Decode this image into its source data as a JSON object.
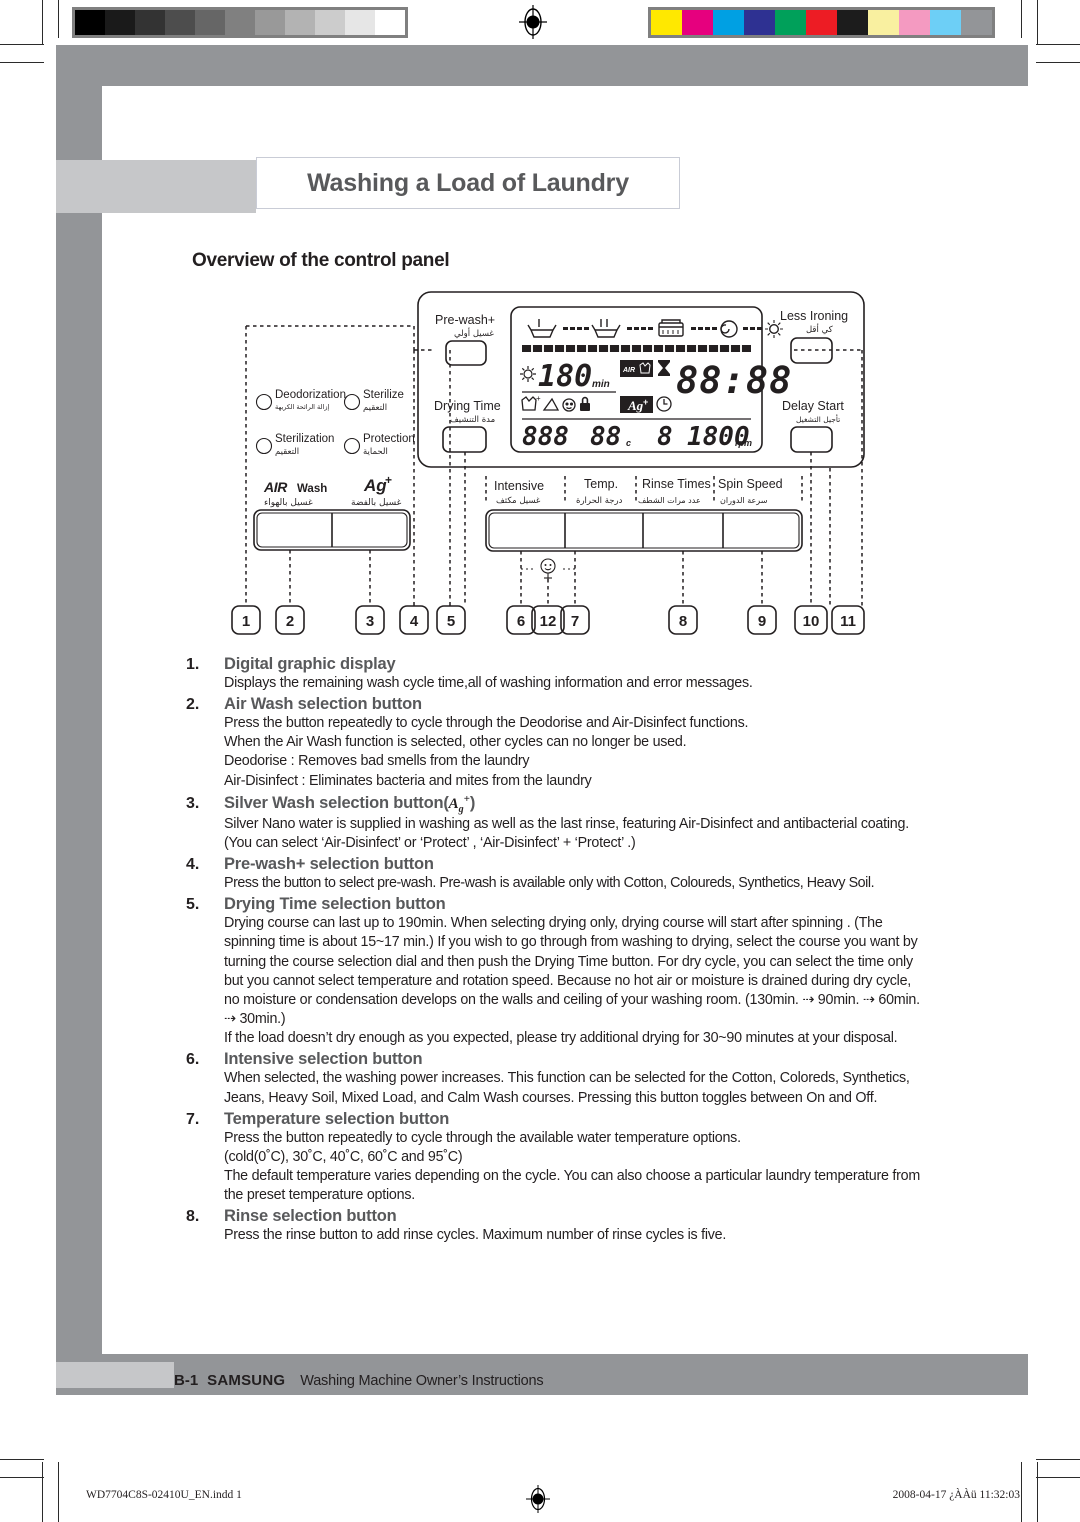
{
  "document": {
    "chapter_title": "Washing a Load of Laundry",
    "section_heading": "Overview of the control panel"
  },
  "calibration": {
    "gray_swatches": [
      "#000000",
      "#1a1a1a",
      "#333333",
      "#4d4d4d",
      "#666666",
      "#808080",
      "#999999",
      "#b3b3b3",
      "#cccccc",
      "#e6e6e6",
      "#ffffff"
    ],
    "color_swatches": [
      "#ffe800",
      "#e6007e",
      "#00a0e3",
      "#2e3192",
      "#00a05a",
      "#ed1c24",
      "#1c1c1c",
      "#f9f0a0",
      "#f49ac1",
      "#6dcff6",
      "#939598"
    ]
  },
  "diagram": {
    "name": "washing-machine-control-panel",
    "indicators": [
      {
        "en": "Deodorization",
        "ar": "إزالة الرائحة الكريهة"
      },
      {
        "en": "Sterilize",
        "ar": "التعقيم"
      },
      {
        "en": "Sterilization",
        "ar": "التعقيم"
      },
      {
        "en": "Protection",
        "ar": "الحماية"
      }
    ],
    "left_buttons": [
      {
        "en": "AIR Wash",
        "ar": "غسيل بالهواء"
      },
      {
        "en": "Ag+",
        "ar": "غسيل بالفضة"
      }
    ],
    "column_buttons": [
      {
        "en": "Pre-wash+",
        "ar": "غسيل أولي"
      },
      {
        "en": "Drying Time",
        "ar": "مدة التنشيف"
      }
    ],
    "right_buttons": [
      {
        "en": "Less Ironing",
        "ar": "كي أقل"
      },
      {
        "en": "Delay Start",
        "ar": "تأجيل التشغيل"
      }
    ],
    "center_buttons": [
      {
        "en": "Intensive",
        "ar": "غسيل مكثف"
      },
      {
        "en": "Temp.",
        "ar": "درجة الحرارة"
      },
      {
        "en": "Rinse Times",
        "ar": "عدد مرات الشطف"
      },
      {
        "en": "Spin Speed",
        "ar": "سرعة الدوران"
      }
    ],
    "lcd": {
      "drying_value": "180",
      "drying_unit": "min",
      "main_time": "88:88",
      "bottom_course": "888",
      "bottom_temp": "88",
      "bottom_temp_unit": "c",
      "bottom_rinse": "8",
      "bottom_spin": "1800",
      "bottom_spin_unit": "rpm",
      "badge_air": "AIR",
      "badge_silver": "Ag+"
    },
    "callouts": [
      "1",
      "2",
      "3",
      "4",
      "5",
      "6",
      "12",
      "7",
      "8",
      "9",
      "10",
      "11"
    ]
  },
  "instructions": [
    {
      "num": "1.",
      "title": "Digital graphic display",
      "body": [
        "Displays the remaining wash cycle time,all of washing information and error messages."
      ]
    },
    {
      "num": "2.",
      "title": "Air Wash selection button",
      "body": [
        "Press the button repeatedly to cycle through the Deodorise and Air-Disinfect functions.",
        "When the Air Wash function is selected, other cycles can no longer be used.",
        "Deodorise :  Removes bad smells from the laundry",
        "Air-Disinfect :  Eliminates bacteria and mites from the laundry"
      ]
    },
    {
      "num": "3.",
      "title": "Silver Wash selection button(",
      "title_suffix": ")",
      "body": [
        "Silver Nano water is supplied in washing as well as the last rinse, featuring Air-Disinfect and antibacterial coating. (You can select ‘Air-Disinfect’ or ‘Protect’ , ‘Air-Disinfect’ + ‘Protect’ .)"
      ]
    },
    {
      "num": "4.",
      "title": "Pre-wash+ selection button",
      "body": [
        "Press the button to select pre-wash. Pre-wash is available only with Cotton, Coloureds, Synthetics, Heavy Soil."
      ]
    },
    {
      "num": "5.",
      "title": "Drying Time selection button",
      "body": [
        "Drying course can last up to 190min. When selecting drying only, drying course will start after spinning . (The spinning time is about 15~17 min.) If you wish to go through from washing to drying, select the course you want by turning the course selection dial and then push the Drying Time button. For dry cycle, you can select the time only but you cannot select temperature and rotation speed.  Because no hot air or moisture is drained during dry cycle, no moisture or condensation develops on the walls and ceiling of your washing room.  (130min. ⇢ 90min. ⇢ 60min. ⇢ 30min.)",
        "If the load doesn’t dry enough as you expected, please try additional drying for 30~90 minutes at your disposal."
      ]
    },
    {
      "num": "6.",
      "title": "Intensive selection button",
      "body": [
        "When selected, the washing power increases. This function can be selected for the Cotton, Coloreds, Synthetics, Jeans, Heavy Soil, Mixed Load, and Calm Wash courses. Pressing this button toggles between On and Off."
      ]
    },
    {
      "num": "7.",
      "title": "Temperature selection button",
      "body": [
        "Press the button repeatedly to cycle through the available water temperature options.",
        "(cold(0˚C), 30˚C, 40˚C, 60˚C and 95˚C)",
        "The default temperature varies depending on the cycle. You can also choose a particular laundry temperature from the preset temperature options."
      ]
    },
    {
      "num": "8.",
      "title": "Rinse selection button",
      "body": [
        "Press the rinse button to add rinse cycles. Maximum number of rinse cycles is five."
      ]
    }
  ],
  "footer": {
    "page": "B-1",
    "brand": "SAMSUNG",
    "doc_title": "Washing Machine Owner’s Instructions"
  },
  "print_slug": {
    "file": "WD7704C8S-02410U_EN.indd   1",
    "date": "2008-04-17   ¿ÀÀü 11:32:03"
  }
}
